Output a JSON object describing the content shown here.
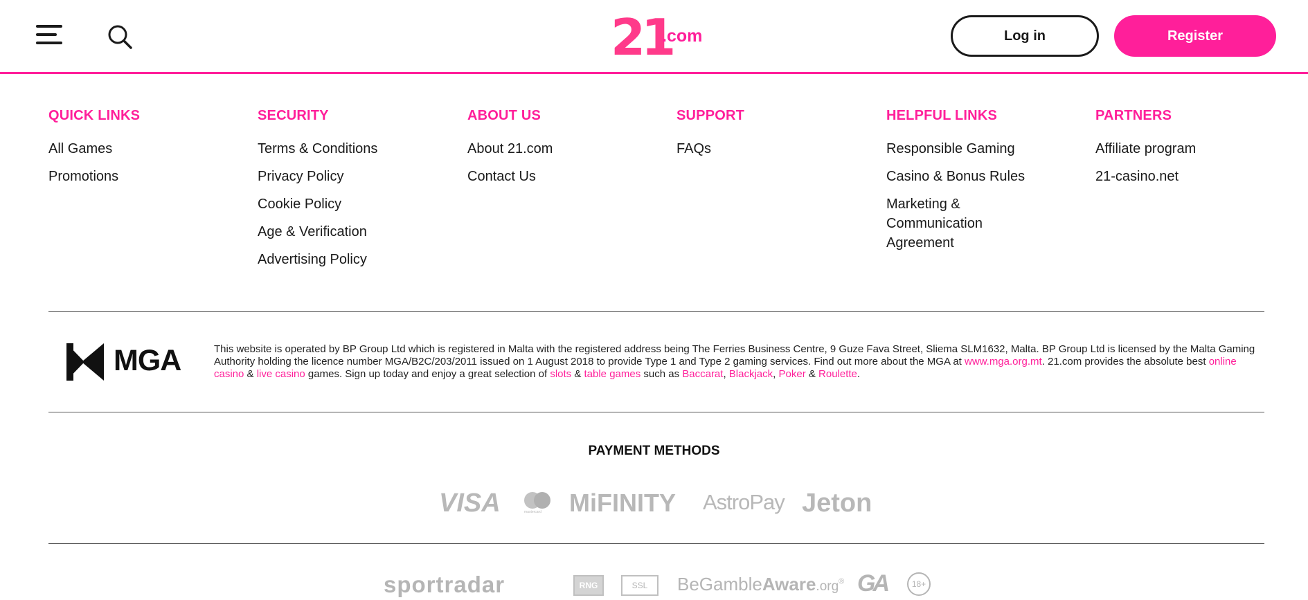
{
  "header": {
    "menu_icon": "hamburger-menu-icon",
    "search_icon": "search-icon",
    "logo": {
      "number": "21",
      "domain": ".com"
    },
    "login_label": "Log in",
    "register_label": "Register",
    "accent_color": "#ff1f9a"
  },
  "footer_links": {
    "columns": [
      {
        "title": "QUICK LINKS",
        "items": [
          "All Games",
          "Promotions"
        ]
      },
      {
        "title": "SECURITY",
        "items": [
          "Terms & Conditions",
          "Privacy Policy",
          "Cookie Policy",
          "Age & Verification",
          "Advertising Policy"
        ]
      },
      {
        "title": "ABOUT US",
        "items": [
          "About 21.com",
          "Contact Us"
        ]
      },
      {
        "title": "SUPPORT",
        "items": [
          "FAQs"
        ]
      },
      {
        "title": "HELPFUL LINKS",
        "items": [
          "Responsible Gaming",
          "Casino & Bonus Rules",
          "Marketing & Communication Agreement"
        ]
      },
      {
        "title": "PARTNERS",
        "items": [
          "Affiliate program",
          "21-casino.net"
        ]
      }
    ]
  },
  "license": {
    "mga_label": "MGA",
    "text_1": "This website is operated by BP Group Ltd which is registered in Malta with the registered address being The Ferries Business Centre, 9 Guze Fava Street, Sliema SLM1632, Malta. BP Group Ltd is licensed by the Malta Gaming Authority holding the licence number MGA/B2C/203/2011 issued on 1 August 2018 to provide Type 1 and Type 2 gaming services. Find out more about the MGA at ",
    "link_mga": "www.mga.org.mt",
    "text_2": ". 21.com provides the absolute best ",
    "link_online_casino": "online casino",
    "amp_1": " & ",
    "link_live_casino": "live casino",
    "text_3": " games. Sign up today and enjoy a great selection of ",
    "link_slots": "slots",
    "amp_2": " & ",
    "link_table_games": "table games",
    "text_4": " such as ",
    "link_baccarat": "Baccarat",
    "comma_1": ", ",
    "link_blackjack": "Blackjack",
    "comma_2": ", ",
    "link_poker": "Poker",
    "amp_3": " & ",
    "link_roulette": "Roulette",
    "period": "."
  },
  "payments": {
    "title": "PAYMENT METHODS",
    "visa": "VISA",
    "mastercard_caption": "mastercard",
    "mifinity": "MiFINITY",
    "astropay": "AstroPay",
    "jeton": "Jeton"
  },
  "trust": {
    "sportradar": "sportradar",
    "rng": "RNG",
    "ssl": "SSL",
    "gamble_aware_1": "BeGamble",
    "gamble_aware_2": "Aware",
    "gamble_aware_3": ".org",
    "gamble_aware_reg": "®",
    "ga": "GA",
    "age": "18+"
  }
}
